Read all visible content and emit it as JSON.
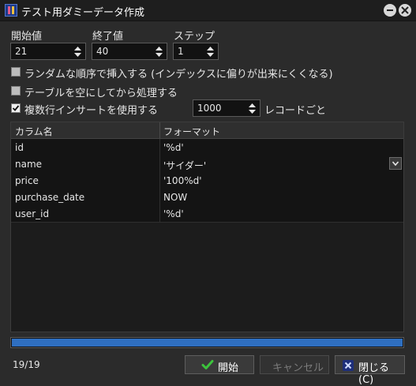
{
  "window": {
    "title": "テスト用ダミーデータ作成"
  },
  "range": {
    "start_label": "開始値",
    "start_value": "21",
    "end_label": "終了値",
    "end_value": "40",
    "step_label": "ステップ",
    "step_value": "1"
  },
  "options": {
    "random_order": {
      "label": "ランダムな順序で挿入する (インデックスに偏りが出来にくくなる)",
      "checked": false
    },
    "truncate": {
      "label": "テーブルを空にしてから処理する",
      "checked": false
    },
    "multi_insert": {
      "label": "複数行インサートを使用する",
      "checked": true
    },
    "batch_value": "1000",
    "batch_suffix": "レコードごと"
  },
  "grid": {
    "columns": [
      "カラム名",
      "フォーマット"
    ],
    "rows": [
      {
        "name": "id",
        "format": "'%d'"
      },
      {
        "name": "name",
        "format": "'サイダー'"
      },
      {
        "name": "price",
        "format": "'100%d'"
      },
      {
        "name": "purchase_date",
        "format": "NOW"
      },
      {
        "name": "user_id",
        "format": "'%d'"
      }
    ]
  },
  "progress": {
    "value": 1.0,
    "color": "#2f6fc0"
  },
  "status": {
    "text": "19/19"
  },
  "buttons": {
    "start": "開始",
    "cancel": "キャンセル",
    "close": "閉じる(C)"
  },
  "icons": {
    "app": "app-icon",
    "minimize": "minimize-icon",
    "close": "close-circle-icon",
    "check": "green-check-icon",
    "x": "blue-x-icon"
  }
}
